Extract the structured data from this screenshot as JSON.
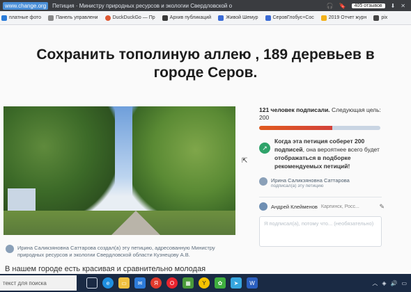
{
  "browser": {
    "url": "www.change.org",
    "tab_title": "Петиция · Министру природных ресурсов и экологии Свердловской о",
    "reviews_badge": "405 отзывов"
  },
  "bookmarks": [
    {
      "label": "платные фото",
      "color": "#2a7bd8"
    },
    {
      "label": "Панель управлени",
      "color": "#888888"
    },
    {
      "label": "DuckDuckGo — Пр",
      "color": "#de5833"
    },
    {
      "label": "Архив публикаций",
      "color": "#3a3a3a"
    },
    {
      "label": "Живой Шемур",
      "color": "#3b6bd6"
    },
    {
      "label": "СеровГлобус+Сос",
      "color": "#3b6bd6"
    },
    {
      "label": "2019 Отчет журн",
      "color": "#f3b21b"
    },
    {
      "label": "pix",
      "color": "#444444"
    }
  ],
  "petition": {
    "title_line1": "Сохранить тополиную аллею , 189 деревьев в",
    "title_line2": "городе Серов.",
    "author_text": "Ирина Саликзяновна Саттарова создал(а) эту петицию, адресованную Министру природных ресурсов и экологии Свердловской области Кузнецову А.В.",
    "body_start": "В нашем городе есть красивая и сравнительно молодая"
  },
  "sidebar": {
    "signed_count": "121 человек подписали.",
    "next_goal": "Следующая цель: 200",
    "progress_fraction": 0.605,
    "goal_text_1": "Когда эта петиция соберет 200",
    "goal_text_2": "подписей",
    "goal_text_3": ", она вероятнее всего",
    "goal_text_4": "будет",
    "goal_text_5": "отображаться в подборке рекомендуемых петиций!",
    "recent_signer_name": "Ирина Саликзяновна Саттарова",
    "recent_signer_sub": "подписал(а) эту петицию",
    "commenter_name": "Андрей Клейменов",
    "commenter_location": "Карпинск, Росс...",
    "comment_placeholder": "Я подписал(а), потому что... (необязательно)"
  },
  "taskbar": {
    "search_placeholder": "текст для поиска",
    "apps": [
      "windows",
      "edge",
      "explorer",
      "mail",
      "yandex",
      "opera",
      "store",
      "yandex-browser",
      "telegram",
      "photos",
      "word"
    ]
  }
}
